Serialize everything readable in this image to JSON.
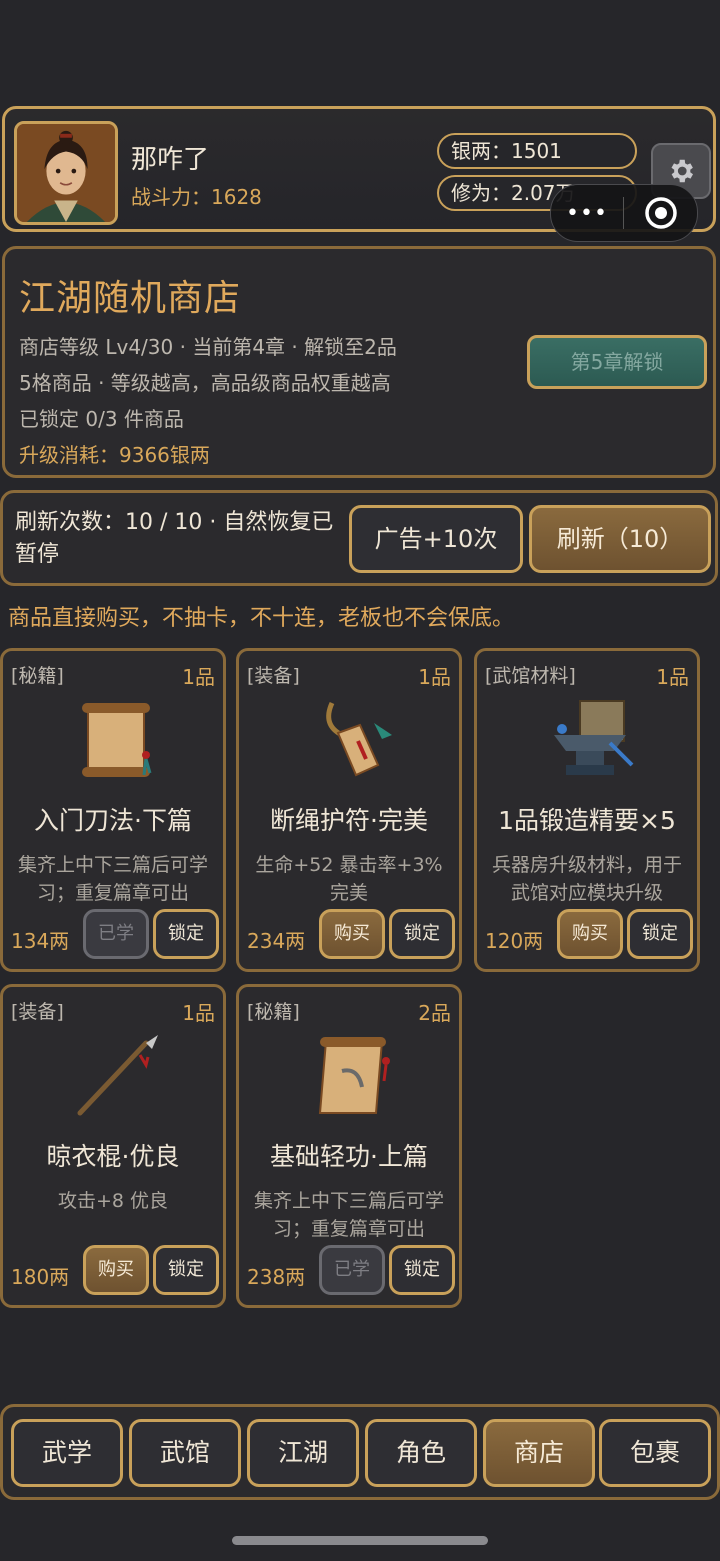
{
  "player": {
    "name": "那咋了",
    "power": "战斗力：1628",
    "silver": "银两：1501",
    "cultivation": "修为：2.07万"
  },
  "shop": {
    "title": "江湖随机商店",
    "line1": "商店等级 Lv4/30 · 当前第4章 · 解锁至2品",
    "line2": "5格商品 · 等级越高，高品级商品权重越高",
    "line3": "已锁定 0/3 件商品",
    "upgrade_cost": "升级消耗：9366银两",
    "unlock_label": "第5章解锁"
  },
  "refresh": {
    "text": "刷新次数：10 / 10 · 自然恢复已暂停",
    "ad_label": "广告+10次",
    "refresh_label": "刷新（10）"
  },
  "notice": "商品直接购买，不抽卡，不十连，老板也不会保底。",
  "items": [
    {
      "tag": "[秘籍]",
      "grade": "1品",
      "name": "入门刀法·下篇",
      "desc": "集齐上中下三篇后可学习；重复篇章可出",
      "price": "134两",
      "action": "已学",
      "lock": "锁定"
    },
    {
      "tag": "[装备]",
      "grade": "1品",
      "name": "断绳护符·完美",
      "desc": "生命+52 暴击率+3% 完美",
      "price": "234两",
      "action": "购买",
      "lock": "锁定"
    },
    {
      "tag": "[武馆材料]",
      "grade": "1品",
      "name": "1品锻造精要×5",
      "desc": "兵器房升级材料，用于武馆对应模块升级",
      "price": "120两",
      "action": "购买",
      "lock": "锁定"
    },
    {
      "tag": "[装备]",
      "grade": "1品",
      "name": "晾衣棍·优良",
      "desc": "攻击+8 优良",
      "price": "180两",
      "action": "购买",
      "lock": "锁定"
    },
    {
      "tag": "[秘籍]",
      "grade": "2品",
      "name": "基础轻功·上篇",
      "desc": "集齐上中下三篇后可学习；重复篇章可出",
      "price": "238两",
      "action": "已学",
      "lock": "锁定"
    }
  ],
  "nav": [
    "武学",
    "武馆",
    "江湖",
    "角色",
    "商店",
    "包裹"
  ],
  "capsule": {
    "menu": "•••"
  }
}
